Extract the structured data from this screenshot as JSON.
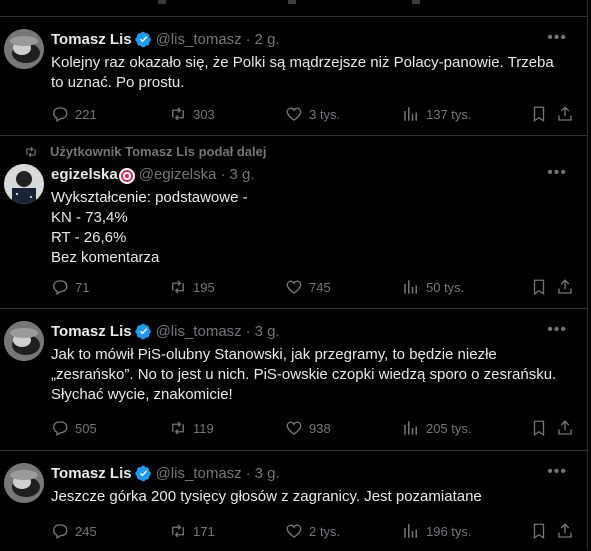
{
  "tweets": [
    {
      "name": "Tomasz Lis",
      "handle": "@lis_tomasz",
      "separator": "·",
      "time": "2 g.",
      "text_lines": [
        "Kolejny raz okazało się, że Polki są mądrzejsze niż Polacy-panowie. Trzeba",
        "to uznać. Po prostu."
      ],
      "replies": "221",
      "reposts": "303",
      "likes": "3 tys.",
      "views": "137 tys."
    },
    {
      "repost_note": "Użytkownik Tomasz Lis podał dalej",
      "name": "egizelska",
      "handle": "@egizelska",
      "separator": "·",
      "time": "3 g.",
      "text_lines": [
        "Wykształcenie: podstawowe -",
        "KN - 73,4%",
        "RT - 26,6%",
        "Bez komentarza"
      ],
      "replies": "71",
      "reposts": "195",
      "likes": "745",
      "views": "50 tys."
    },
    {
      "name": "Tomasz Lis",
      "handle": "@lis_tomasz",
      "separator": "·",
      "time": "3 g.",
      "text_lines": [
        "Jak to mówił PiS-olubny Stanowski, jak przegramy, to będzie niezłe",
        "„zesrańsko”. No to jest u nich. PiS-owskie czopki wiedzą sporo o zesrańsku.",
        "Słychać wycie, znakomicie!"
      ],
      "replies": "505",
      "reposts": "119",
      "likes": "938",
      "views": "205 tys."
    },
    {
      "name": "Tomasz Lis",
      "handle": "@lis_tomasz",
      "separator": "·",
      "time": "3 g.",
      "text_lines": [
        "Jeszcze górka 200 tysięcy głosów z zagranicy. Jest pozamiatane"
      ],
      "replies": "245",
      "reposts": "171",
      "likes": "2 tys.",
      "views": "196 tys."
    }
  ],
  "icons": {
    "more": "more-icon",
    "reply": "reply-icon",
    "repost": "repost-icon",
    "like": "heart-icon",
    "views": "views-icon",
    "bookmark": "bookmark-icon",
    "share": "share-icon",
    "verified": "verified-badge-icon"
  },
  "colors": {
    "background": "#000000",
    "text": "#e7e9ea",
    "muted": "#71767b",
    "border": "#2f3336",
    "verified": "#1d9bf0"
  }
}
